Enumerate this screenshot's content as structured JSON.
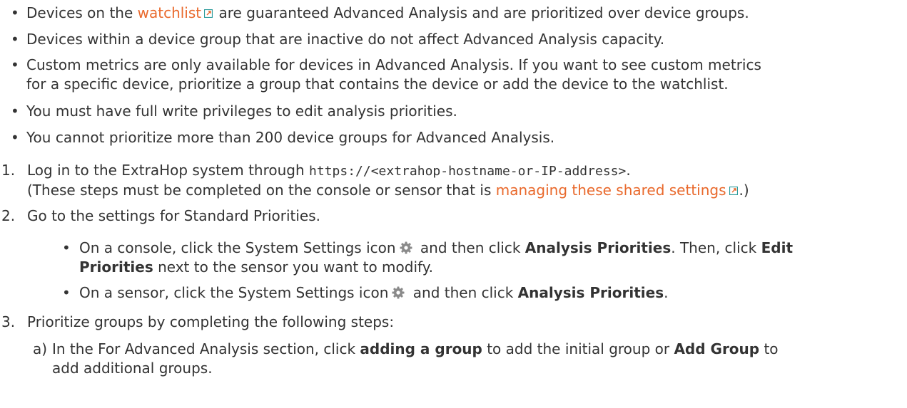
{
  "bullets": [
    {
      "pre": "Devices on the ",
      "link": "watchlist",
      "post": " are guaranteed Advanced Analysis and are prioritized over device groups."
    },
    {
      "text": "Devices within a device group that are inactive do not affect Advanced Analysis capacity."
    },
    {
      "line1": "Custom metrics are only available for devices in Advanced Analysis. If you want to see custom metrics",
      "line2": "for a specific device, prioritize a group that contains the device or add the device to the watchlist."
    },
    {
      "text": "You must have full write privileges to edit analysis priorities."
    },
    {
      "text": "You cannot prioritize more than 200 device groups for Advanced Analysis."
    }
  ],
  "steps": [
    {
      "num": "1.",
      "pre": "Log in to the ExtraHop system through ",
      "code": "https://<extrahop-hostname-or-IP-address>",
      "post": ".",
      "note_pre": "(These steps must be completed on the console or sensor that is ",
      "note_link": "managing these shared settings",
      "note_post": ".)"
    },
    {
      "num": "2.",
      "text": "Go to the settings for Standard Priorities.",
      "subs": [
        {
          "a": "On a console, click the System Settings icon",
          "b": " and then click ",
          "c": "Analysis Priorities",
          "d": ". Then, click ",
          "e": "Edit",
          "f": "Priorities",
          "g": " next to the sensor you want to modify."
        },
        {
          "a": "On a sensor, click the System Settings icon",
          "b": " and then click ",
          "c": "Analysis Priorities",
          "d": "."
        }
      ]
    },
    {
      "num": "3.",
      "text": "Prioritize groups by completing the following steps:",
      "substep": {
        "label": "a)",
        "a": "In the For Advanced Analysis section, click ",
        "b": "adding a group",
        "c": " to add the initial group or ",
        "d": "Add Group",
        "e": " to",
        "f": "add additional groups."
      }
    }
  ],
  "icons": {
    "external": "external-link-icon",
    "gear": "gear-icon"
  },
  "colors": {
    "link": "#e9692c",
    "text": "#333333",
    "external_icon": "#2a9a9a"
  }
}
